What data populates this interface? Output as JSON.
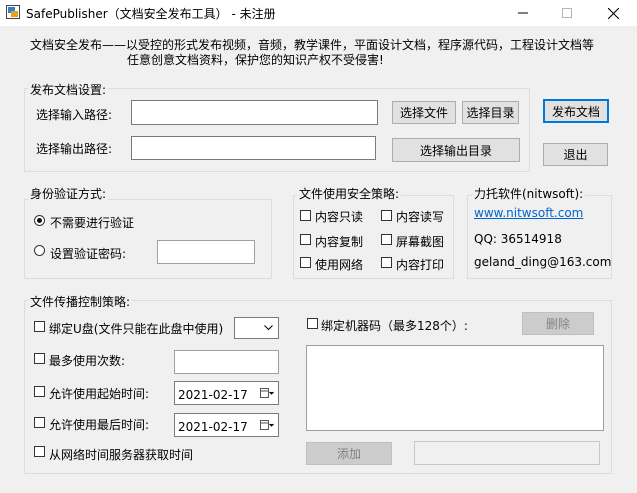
{
  "window": {
    "title": "SafePublisher（文档安全发布工具） - 未注册",
    "minimize": "—",
    "maximize": "☐",
    "close": "✕"
  },
  "description": {
    "line1": "文档安全发布——以受控的形式发布视频，音频，教学课件，平面设计文档，程序源代码，工程设计文档等",
    "line2": "任意创意文档资料，保护您的知识产权不受侵害!"
  },
  "publish_settings": {
    "title": "发布文档设置:",
    "input_label": "选择输入路径:",
    "input_value": "",
    "output_label": "选择输出路径:",
    "output_value": "",
    "select_file": "选择文件",
    "select_dir": "选择目录",
    "select_output_dir": "选择输出目录"
  },
  "actions": {
    "publish": "发布文档",
    "exit": "退出"
  },
  "auth": {
    "title": "身份验证方式:",
    "no_verify": "不需要进行验证",
    "set_password": "设置验证密码:",
    "password_value": "",
    "selected": "no_verify"
  },
  "policy": {
    "title": "文件使用安全策略:",
    "items": [
      {
        "label": "内容只读",
        "checked": false
      },
      {
        "label": "内容读写",
        "checked": false
      },
      {
        "label": "内容复制",
        "checked": false
      },
      {
        "label": "屏幕截图",
        "checked": false
      },
      {
        "label": "使用网络",
        "checked": false
      },
      {
        "label": "内容打印",
        "checked": false
      }
    ]
  },
  "vendor": {
    "title": "力托软件(nitwsoft):",
    "url": "www.nitwsoft.com",
    "qq": "QQ:  36514918",
    "email": "geland_ding@163.com"
  },
  "transfer": {
    "title": "文件传播控制策略:",
    "bind_usb": "绑定U盘(文件只能在此盘中使用)",
    "max_uses": "最多使用次数:",
    "max_uses_value": "",
    "start_time": "允许使用起始时间:",
    "start_date": "2021-02-17",
    "end_time": "允许使用最后时间:",
    "end_date": "2021-02-17",
    "net_time": "从网络时间服务器获取时间",
    "bind_machine": "绑定机器码（最多128个）:",
    "delete": "删除",
    "add": "添加",
    "machine_code_value": ""
  }
}
